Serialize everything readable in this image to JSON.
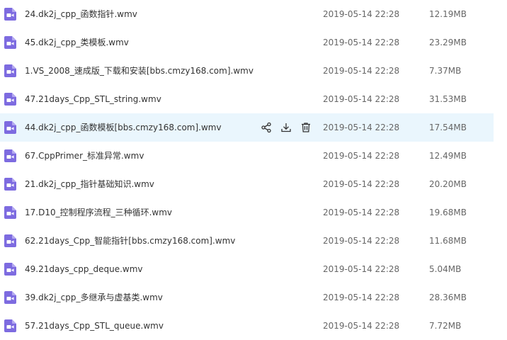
{
  "colors": {
    "file_icon": "#7d6be0",
    "hover_row": "#eaf6fd",
    "action_icon": "#333333"
  },
  "icons": {
    "file": "video-file-icon",
    "share": "share-icon",
    "download": "download-icon",
    "delete": "trash-icon"
  },
  "files": [
    {
      "name": "24.dk2j_cpp_函数指针.wmv",
      "date": "2019-05-14 22:28",
      "size": "12.19MB"
    },
    {
      "name": "45.dk2j_cpp_类模板.wmv",
      "date": "2019-05-14 22:28",
      "size": "23.29MB"
    },
    {
      "name": "1.VS_2008_速成版_下载和安装[bbs.cmzy168.com].wmv",
      "date": "2019-05-14 22:28",
      "size": "7.37MB"
    },
    {
      "name": "47.21days_Cpp_STL_string.wmv",
      "date": "2019-05-14 22:28",
      "size": "31.53MB"
    },
    {
      "name": "44.dk2j_cpp_函数模板[bbs.cmzy168.com].wmv",
      "date": "2019-05-14 22:28",
      "size": "17.54MB",
      "hover": true
    },
    {
      "name": "67.CppPrimer_标准异常.wmv",
      "date": "2019-05-14 22:28",
      "size": "12.49MB"
    },
    {
      "name": "21.dk2j_cpp_指针基础知识.wmv",
      "date": "2019-05-14 22:28",
      "size": "20.20MB"
    },
    {
      "name": "17.D10_控制程序流程_三种循环.wmv",
      "date": "2019-05-14 22:28",
      "size": "19.68MB"
    },
    {
      "name": "62.21days_Cpp_智能指针[bbs.cmzy168.com].wmv",
      "date": "2019-05-14 22:28",
      "size": "11.68MB"
    },
    {
      "name": "49.21days_cpp_deque.wmv",
      "date": "2019-05-14 22:28",
      "size": "5.04MB"
    },
    {
      "name": "39.dk2j_cpp_多继承与虚基类.wmv",
      "date": "2019-05-14 22:28",
      "size": "28.36MB"
    },
    {
      "name": "57.21days_Cpp_STL_queue.wmv",
      "date": "2019-05-14 22:28",
      "size": "7.72MB"
    }
  ]
}
